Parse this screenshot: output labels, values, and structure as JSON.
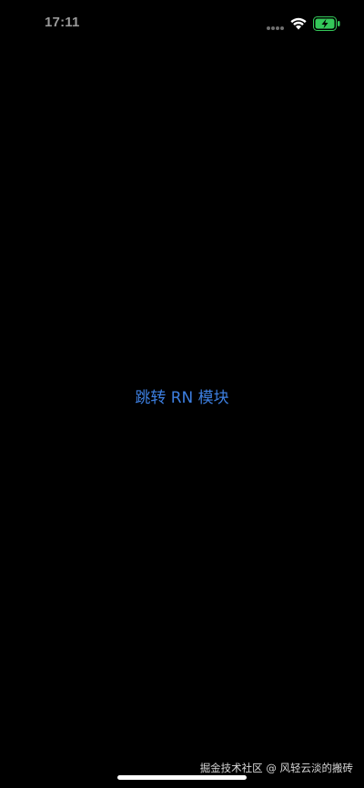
{
  "status_bar": {
    "time": "17:11",
    "wifi_icon": "wifi-icon",
    "battery_icon": "battery-charging-icon",
    "signal_icon": "signal-dots-icon"
  },
  "main": {
    "action_label": "跳转 RN 模块"
  },
  "watermark": {
    "text": "掘金技术社区 @ 风轻云淡的搬砖"
  },
  "colors": {
    "background": "#000000",
    "link": "#3d7fe0",
    "battery": "#34c759"
  }
}
